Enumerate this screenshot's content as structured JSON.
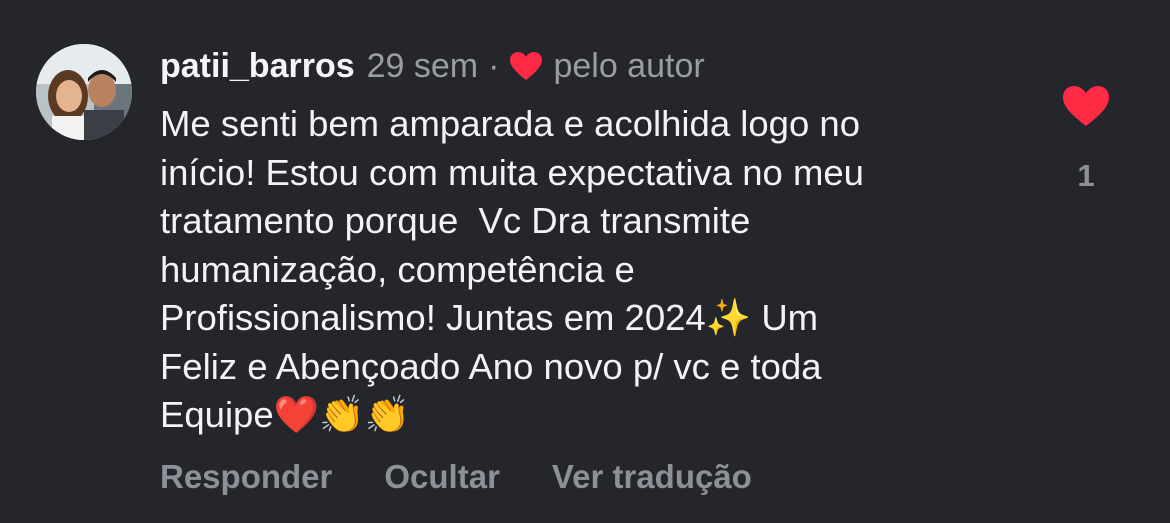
{
  "comment": {
    "username": "patii_barros",
    "time": "29 sem",
    "separator": "·",
    "liked_by_author_label": "pelo autor",
    "text": "Me senti bem amparada e acolhida logo no\ninício! Estou com muita expectativa no meu\ntratamento porque  Vc Dra transmite\nhumanização, competência e\nProfissionalismo! Juntas em 2024✨ Um\nFeliz e Abençoado Ano novo p/ vc e toda\nEquipe❤️👏👏",
    "like_count": "1"
  },
  "actions": {
    "reply": "Responder",
    "hide": "Ocultar",
    "translate": "Ver tradução"
  },
  "icons": {
    "author_heart": "heart-icon",
    "like_button": "heart-icon"
  },
  "colors": {
    "background": "#25262b",
    "heart": "#ff2b45",
    "muted_text": "#9a9ca3"
  }
}
